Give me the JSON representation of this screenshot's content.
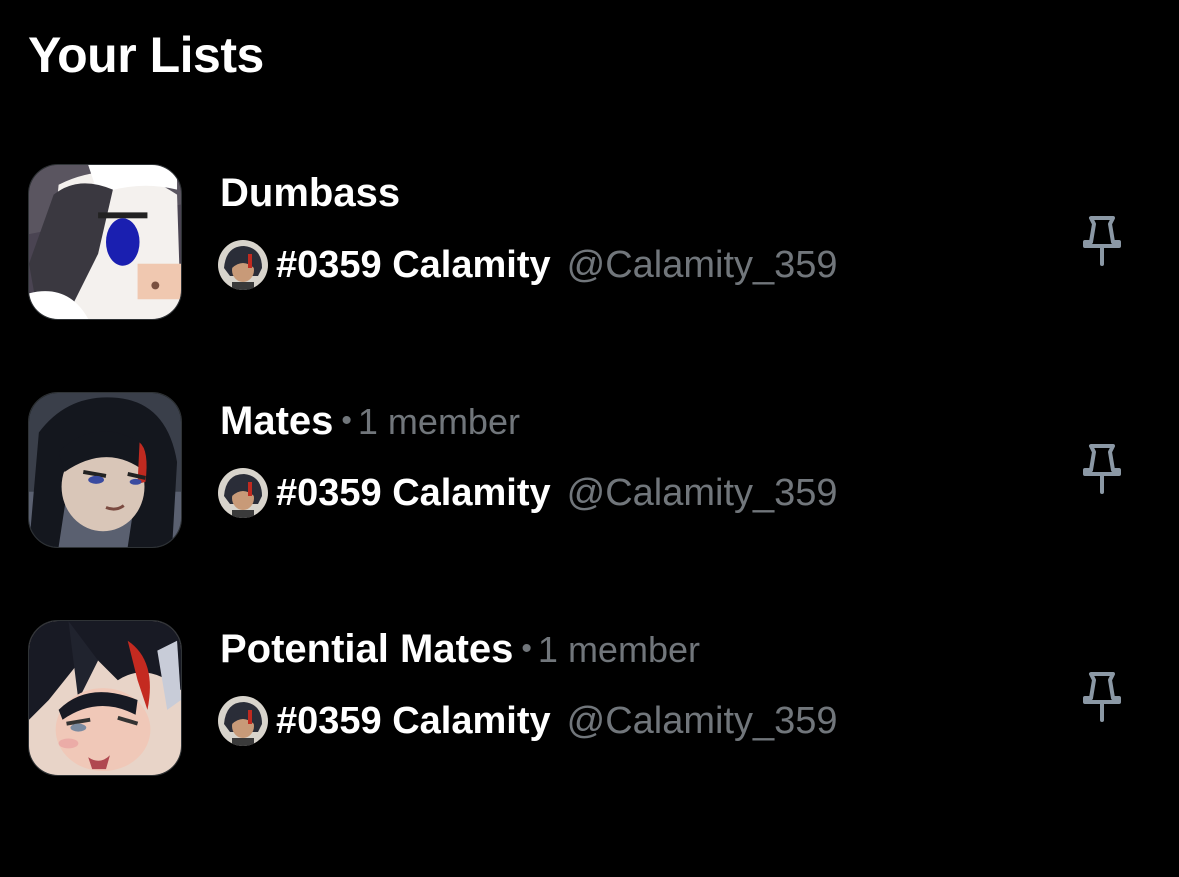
{
  "header": {
    "title": "Your Lists"
  },
  "lists": [
    {
      "name": "Dumbass",
      "separator": "",
      "member_count": "",
      "owner": {
        "name": "#0359 Calamity",
        "handle": "@Calamity_359"
      },
      "pin_icon": "pin-icon"
    },
    {
      "name": "Mates",
      "separator": "•",
      "member_count": "1 member",
      "owner": {
        "name": "#0359 Calamity",
        "handle": "@Calamity_359"
      },
      "pin_icon": "pin-icon"
    },
    {
      "name": "Potential Mates",
      "separator": "•",
      "member_count": "1 member",
      "owner": {
        "name": "#0359 Calamity",
        "handle": "@Calamity_359"
      },
      "pin_icon": "pin-icon"
    }
  ],
  "colors": {
    "background": "#000000",
    "primary_text": "#ffffff",
    "secondary_text": "#71767b",
    "icon": "#8b98a5"
  }
}
